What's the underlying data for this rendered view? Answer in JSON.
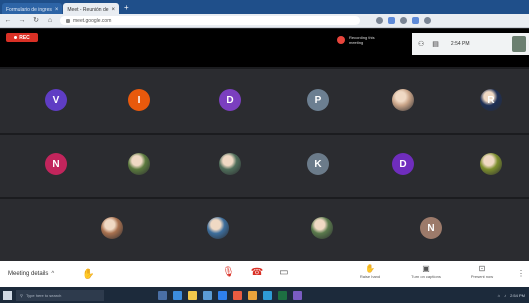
{
  "browser": {
    "tabs": [
      {
        "label": "Formulario de ingres",
        "active": false
      },
      {
        "label": "Meet - Reunión de",
        "active": true
      }
    ],
    "url": "meet.google.com"
  },
  "meeting": {
    "rec_label": "REC",
    "recording_note": "Recording this meeting",
    "time": "2:54 PM",
    "participants": [
      {
        "initial": "V",
        "color": "#5f3dc4",
        "photo": false
      },
      {
        "initial": "I",
        "color": "#e8590c",
        "photo": false
      },
      {
        "initial": "D",
        "color": "#7b3fbf",
        "photo": false
      },
      {
        "initial": "P",
        "color": "#6c7f91",
        "photo": false
      },
      {
        "initial": "",
        "color": "#c9a488",
        "photo": true
      },
      {
        "initial": "R",
        "color": "#1d2f56",
        "photo": true
      },
      {
        "initial": "N",
        "color": "#c2255c",
        "photo": false
      },
      {
        "initial": "",
        "color": "#5b7a3e",
        "photo": true
      },
      {
        "initial": "",
        "color": "#4f6e5a",
        "photo": true
      },
      {
        "initial": "K",
        "color": "#6b7b8a",
        "photo": false
      },
      {
        "initial": "D",
        "color": "#6f2dbd",
        "photo": false
      },
      {
        "initial": "",
        "color": "#7d8f2e",
        "photo": true
      },
      {
        "initial": "",
        "color": "#a8714f",
        "photo": true
      },
      {
        "initial": "",
        "color": "#3d6e9c",
        "photo": true
      },
      {
        "initial": "",
        "color": "#5a7a4c",
        "photo": true
      },
      {
        "initial": "N",
        "color": "#9c7a6a",
        "photo": false
      }
    ],
    "details_label": "Meeting details",
    "right_controls": [
      {
        "label": "Raise hand"
      },
      {
        "label": "Turn on captions"
      },
      {
        "label": "Present now"
      }
    ]
  },
  "taskbar": {
    "search_placeholder": "Type here to search",
    "tray_time": "2:54 PM"
  }
}
